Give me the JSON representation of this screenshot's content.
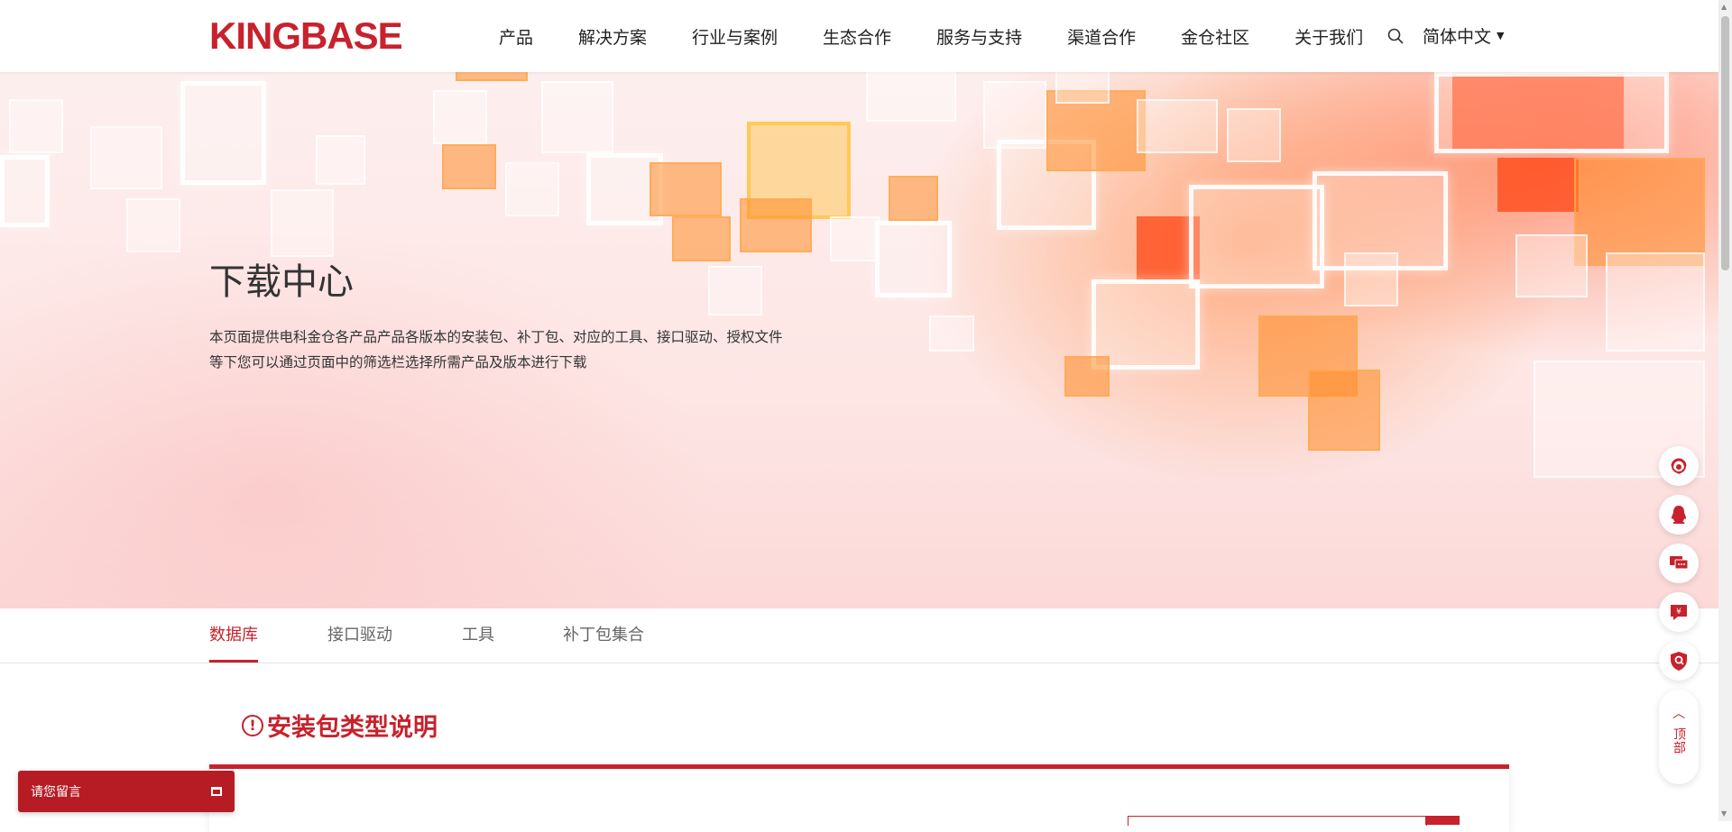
{
  "header": {
    "logo": "KINGBASE",
    "nav": [
      "产品",
      "解决方案",
      "行业与案例",
      "生态合作",
      "服务与支持",
      "渠道合作",
      "金仓社区",
      "关于我们"
    ],
    "language": "简体中文"
  },
  "hero": {
    "title": "下载中心",
    "description_line1": "本页面提供电科金仓各产品产品各版本的安装包、补丁包、对应的工具、接口驱动、授权文件",
    "description_line2": "等下您可以通过页面中的筛选栏选择所需产品及版本进行下载"
  },
  "tabs": [
    {
      "label": "数据库",
      "active": true
    },
    {
      "label": "接口驱动",
      "active": false
    },
    {
      "label": "工具",
      "active": false
    },
    {
      "label": "补丁包集合",
      "active": false
    }
  ],
  "section": {
    "title": "安装包类型说明",
    "icon_glyph": "!"
  },
  "message_widget": {
    "label": "请您留言"
  },
  "float_buttons": [
    "customer-service-icon",
    "qq-icon",
    "chat-icon",
    "price-icon",
    "security-icon"
  ],
  "back_to_top": {
    "label": "顶部"
  },
  "colors": {
    "brand": "#c7222d",
    "widget": "#b71c24"
  }
}
